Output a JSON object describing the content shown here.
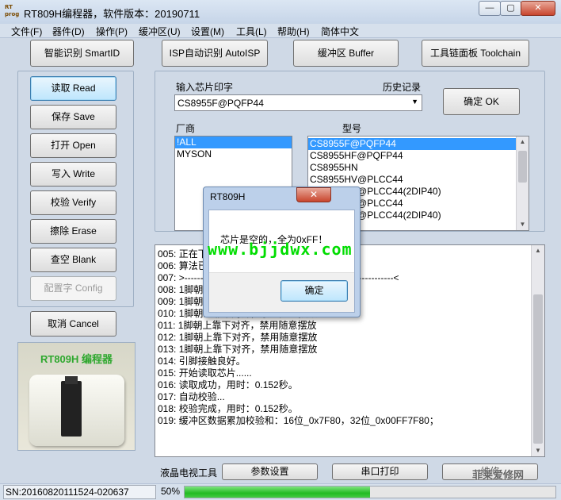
{
  "window": {
    "app_icon_text": "RT\nprog",
    "title": "RT809H编程器，软件版本：20190711",
    "min_glyph": "—",
    "max_glyph": "▢",
    "close_glyph": "✕"
  },
  "menu": [
    "文件(F)",
    "器件(D)",
    "操作(P)",
    "缓冲区(U)",
    "设置(M)",
    "工具(L)",
    "帮助(H)",
    "简体中文"
  ],
  "toolbar": {
    "smartid": "智能识别 SmartID",
    "isp_autoisp": "ISP自动识别 AutoISP",
    "buffer": "缓冲区 Buffer",
    "toolchain": "工具链面板 Toolchain"
  },
  "ops": {
    "read": "读取 Read",
    "save": "保存 Save",
    "open": "打开 Open",
    "write": "写入 Write",
    "verify": "校验 Verify",
    "erase": "擦除 Erase",
    "blank": "查空 Blank",
    "config": "配置字 Config",
    "cancel": "取消 Cancel"
  },
  "product": {
    "label": "RT809H 编程器"
  },
  "chip": {
    "input_label": "输入芯片印字",
    "history_label": "历史记录",
    "value": "CS8955F@PQFP44",
    "ok_button": "确定 OK",
    "vendor_label": "厂商",
    "model_label": "型号",
    "vendors": [
      "!ALL",
      "MYSON"
    ],
    "models": [
      "CS8955F@PQFP44",
      "CS8955HF@PQFP44",
      "CS8955HN",
      "CS8955HV@PLCC44",
      "CS8955HV@PLCC44(2DIP40)",
      "CS8955HV@PLCC44",
      "CS8955HV@PLCC44(2DIP40)"
    ]
  },
  "log": {
    "lines": [
      "005: 正在下载...",
      "006: 算法已载入...",
      "007: >------------------------------------------------------------------<",
      "008: 1脚朝上靠下对齐，禁用随意摆放",
      "009: 1脚朝上靠下对齐，禁用随意摆放",
      "010: 1脚朝上靠下对齐，禁用随意摆放",
      "011: 1脚朝上靠下对齐，禁用随意摆放",
      "012: 1脚朝上靠下对齐，禁用随意摆放",
      "013: 1脚朝上靠下对齐，禁用随意摆放",
      "014: 引脚接触良好。",
      "015: 开始读取芯片......",
      "016: 读取成功，用时：0.152秒。",
      "017: 自动校验...",
      "018: 校验完成，用时：0.152秒。",
      "019: 缓冲区数据累加校验和：16位_0x7F80，32位_0x00FF7F80；"
    ]
  },
  "bottom": {
    "lcd_tool": "液晶电视工具",
    "param_button": "参数设置",
    "serial_button": "串口打印",
    "watermark_small": "维修",
    "watermark_brand": "菲莱爱修网"
  },
  "status": {
    "sn": "SN:20160820111524-020637",
    "progress_text": "50%",
    "progress_value": 0.5
  },
  "dialog": {
    "title": "RT809H",
    "close_glyph": "✕",
    "message": "芯片是空的，全为0xFF！",
    "ok": "确定"
  },
  "watermark": "www.bjjdwx.com",
  "colors": {
    "accent": "#3399ff",
    "watermark": "#00dd00",
    "product_label": "#2fa82f"
  }
}
